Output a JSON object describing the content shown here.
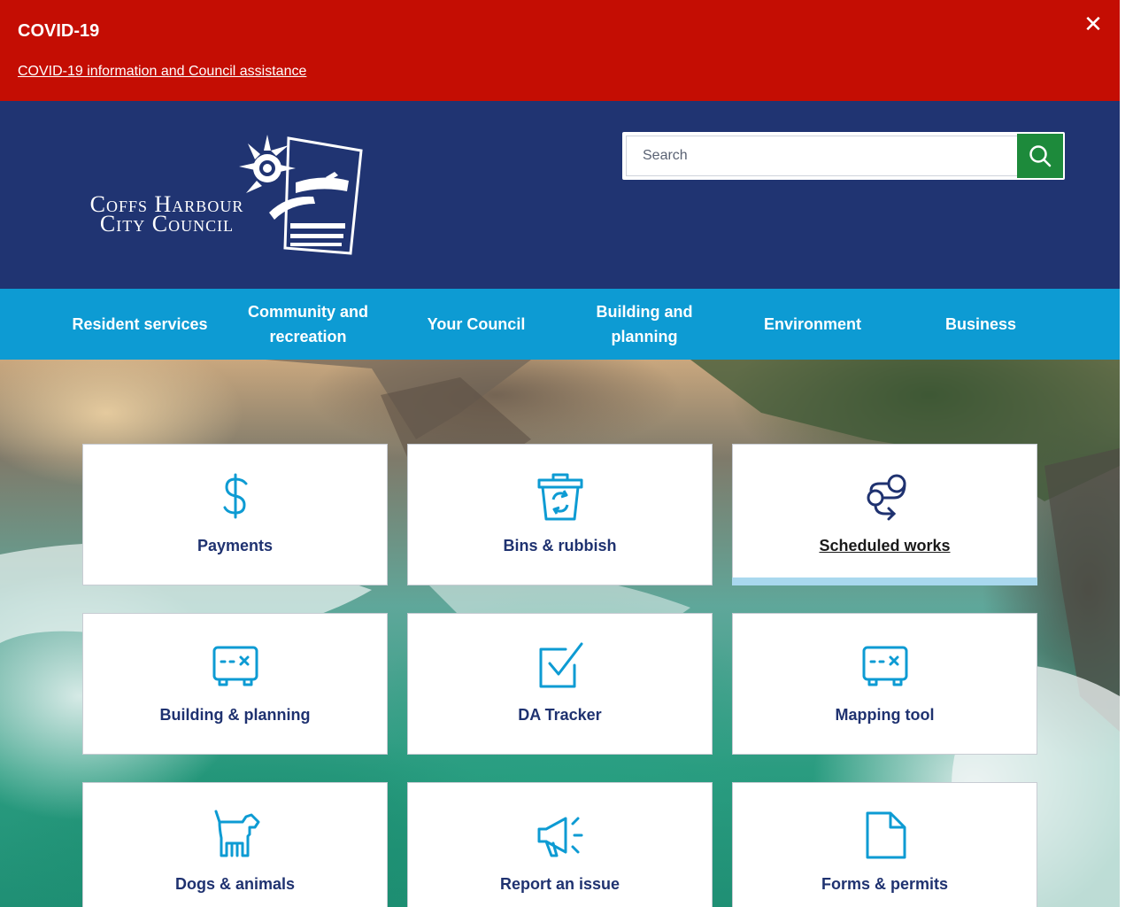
{
  "alert": {
    "title": "COVID-19",
    "link": "COVID-19 information and Council assistance",
    "close_icon": "close-icon"
  },
  "header": {
    "logo_line1": "Coffs Harbour",
    "logo_line2": "City Council",
    "search_placeholder": "Search",
    "search_icon": "search-icon"
  },
  "nav": [
    "Resident services",
    "Community and recreation",
    "Your Council",
    "Building and planning",
    "Environment",
    "Business"
  ],
  "tiles": [
    {
      "label": "Payments",
      "icon": "dollar-icon"
    },
    {
      "label": "Bins & rubbish",
      "icon": "recycle-bin-icon"
    },
    {
      "label": "Scheduled works",
      "icon": "route-icon"
    },
    {
      "label": "Building & planning",
      "icon": "map-ticket-icon"
    },
    {
      "label": "DA Tracker",
      "icon": "checkbox-icon"
    },
    {
      "label": "Mapping tool",
      "icon": "map-ticket-icon"
    },
    {
      "label": "Dogs & animals",
      "icon": "dog-icon"
    },
    {
      "label": "Report an issue",
      "icon": "megaphone-icon"
    },
    {
      "label": "Forms & permits",
      "icon": "document-icon"
    }
  ],
  "colors": {
    "alert_red": "#c40d03",
    "header_navy": "#203472",
    "nav_blue": "#0d9bd3",
    "search_green": "#1d8a3b",
    "icon_blue": "#0d9bd3",
    "tile_text": "#1f3270"
  }
}
